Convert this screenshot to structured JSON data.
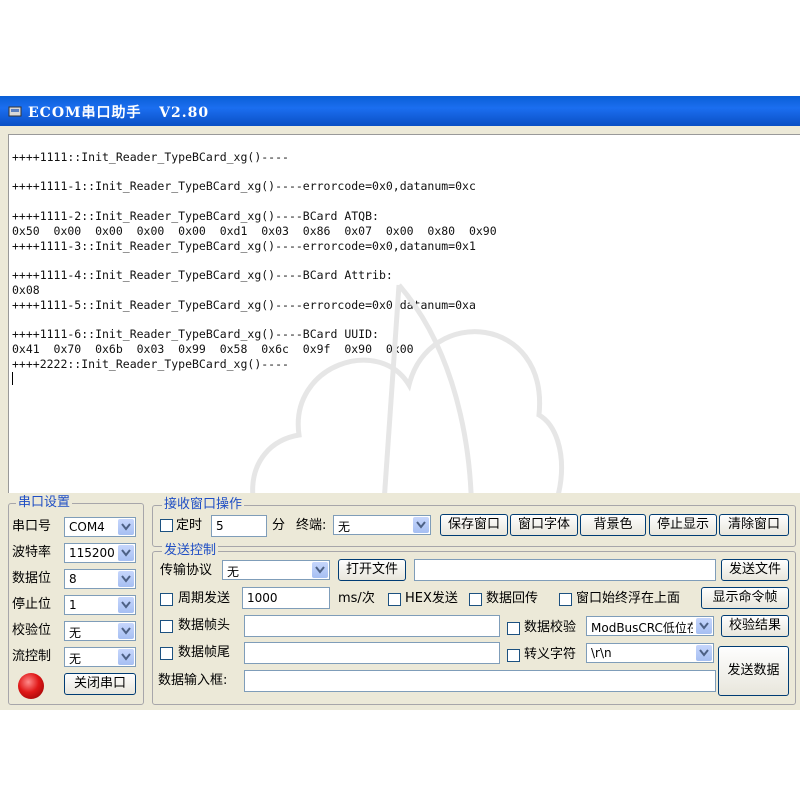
{
  "window": {
    "title": "ECOM串口助手   V2.80"
  },
  "receive": {
    "lines": [
      "",
      "++++1111::Init_Reader_TypeBCard_xg()----",
      "",
      "++++1111-1::Init_Reader_TypeBCard_xg()----errorcode=0x0,datanum=0xc",
      "",
      "++++1111-2::Init_Reader_TypeBCard_xg()----BCard ATQB:",
      "0x50  0x00  0x00  0x00  0x00  0xd1  0x03  0x86  0x07  0x00  0x80  0x90",
      "++++1111-3::Init_Reader_TypeBCard_xg()----errorcode=0x0,datanum=0x1",
      "",
      "++++1111-4::Init_Reader_TypeBCard_xg()----BCard Attrib:",
      "0x08",
      "++++1111-5::Init_Reader_TypeBCard_xg()----errorcode=0x0,datanum=0xa",
      "",
      "++++1111-6::Init_Reader_TypeBCard_xg()----BCard UUID:",
      "0x41  0x70  0x6b  0x03  0x99  0x58  0x6c  0x9f  0x90  0x00",
      "++++2222::Init_Reader_TypeBCard_xg()----"
    ]
  },
  "serial": {
    "legend": "串口设置",
    "port_label": "串口号",
    "port_value": "COM4",
    "baud_label": "波特率",
    "baud_value": "115200",
    "databits_label": "数据位",
    "databits_value": "8",
    "stopbits_label": "停止位",
    "stopbits_value": "1",
    "parity_label": "校验位",
    "parity_value": "无",
    "flow_label": "流控制",
    "flow_value": "无",
    "close_button": "关闭串口",
    "led_color": "#e01818"
  },
  "recv_ops": {
    "legend": "接收窗口操作",
    "timer_label": "定时",
    "timer_value": "5",
    "timer_unit": "分",
    "terminal_label": "终端:",
    "terminal_value": "无",
    "save_button": "保存窗口",
    "font_button": "窗口字体",
    "bg_button": "背景色",
    "stop_button": "停止显示",
    "clear_button": "清除窗口"
  },
  "send": {
    "legend": "发送控制",
    "protocol_label": "传输协议",
    "protocol_value": "无",
    "open_file_button": "打开文件",
    "send_file_button": "发送文件",
    "periodic_label": "周期发送",
    "period_value": "1000",
    "period_unit": "ms/次",
    "hex_label": "HEX发送",
    "echo_label": "数据回传",
    "ontop_label": "窗口始终浮在上面",
    "show_cmd_button": "显示命令帧",
    "frame_head_label": "数据帧头",
    "checksum_label": "数据校验",
    "checksum_value": "ModBusCRC低位在前",
    "checksum_result_button": "校验结果",
    "frame_tail_label": "数据帧尾",
    "escape_label": "转义字符",
    "escape_value": "\\r\\n",
    "input_label": "数据输入框:",
    "send_data_button": "发送数据"
  },
  "colors": {
    "title_bar": "#0a5fd6",
    "legend_text": "#1f4ec4",
    "window_bg": "#ece9d8"
  },
  "icons": {
    "app": "app-icon",
    "dropdown": "chevron-down-icon",
    "indicator": "status-led"
  }
}
